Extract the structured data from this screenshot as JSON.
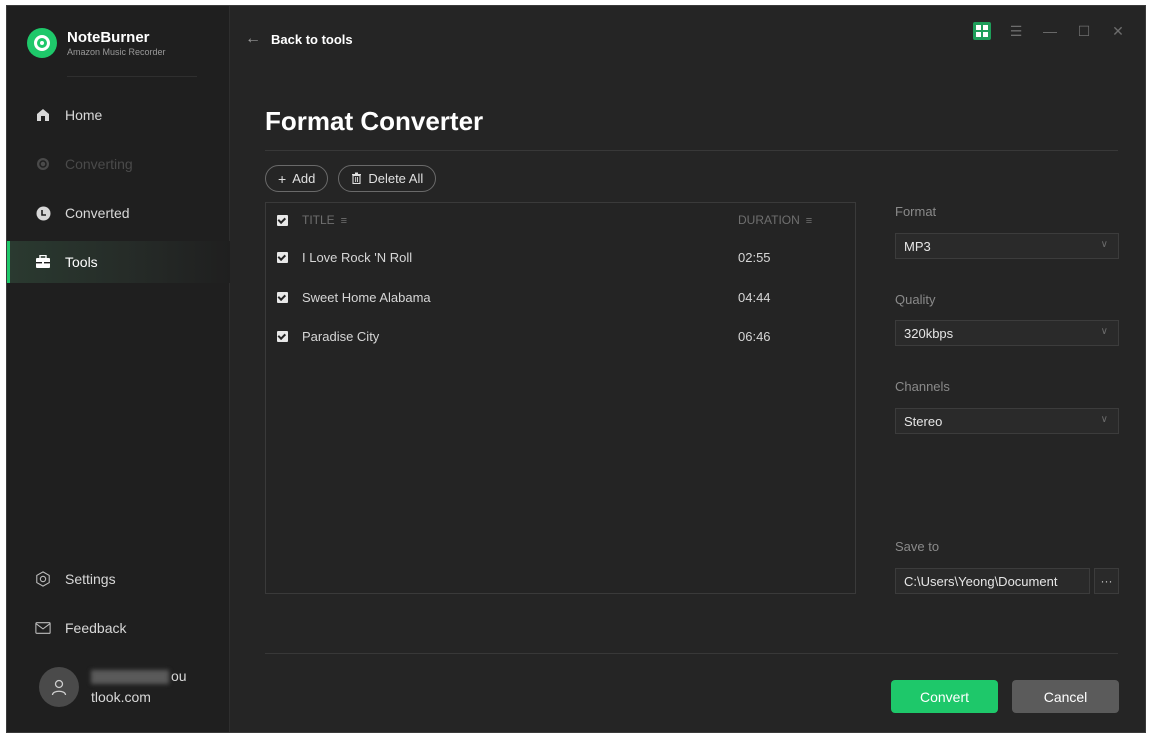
{
  "app": {
    "name": "NoteBurner",
    "subtitle": "Amazon Music Recorder"
  },
  "sidebar": {
    "items": [
      {
        "label": "Home",
        "icon": "home-icon",
        "state": "normal"
      },
      {
        "label": "Converting",
        "icon": "converting-icon",
        "state": "disabled"
      },
      {
        "label": "Converted",
        "icon": "clock-icon",
        "state": "normal"
      },
      {
        "label": "Tools",
        "icon": "toolbox-icon",
        "state": "active"
      }
    ],
    "bottom": [
      {
        "label": "Settings",
        "icon": "gear-icon"
      },
      {
        "label": "Feedback",
        "icon": "mail-icon"
      }
    ],
    "user": {
      "line1_suffix": "ou",
      "line2": "tlook.com"
    }
  },
  "header": {
    "back_label": "Back to tools"
  },
  "page": {
    "title": "Format Converter"
  },
  "toolbar": {
    "add_label": "Add",
    "delete_all_label": "Delete All"
  },
  "list": {
    "columns": {
      "title": "TITLE",
      "duration": "DURATION"
    },
    "rows": [
      {
        "title": "I Love Rock 'N Roll",
        "duration": "02:55",
        "checked": true
      },
      {
        "title": "Sweet Home Alabama",
        "duration": "04:44",
        "checked": true
      },
      {
        "title": "Paradise City",
        "duration": "06:46",
        "checked": true
      }
    ]
  },
  "settings": {
    "format_label": "Format",
    "format_value": "MP3",
    "quality_label": "Quality",
    "quality_value": "320kbps",
    "channels_label": "Channels",
    "channels_value": "Stereo",
    "save_to_label": "Save to",
    "save_to_value": "C:\\Users\\Yeong\\Document",
    "browse_label": "···"
  },
  "actions": {
    "convert_label": "Convert",
    "cancel_label": "Cancel"
  },
  "colors": {
    "accent": "#1ec86a",
    "background": "#252525",
    "sidebar": "#1f1f1f",
    "cancel": "#5b5b5b"
  }
}
